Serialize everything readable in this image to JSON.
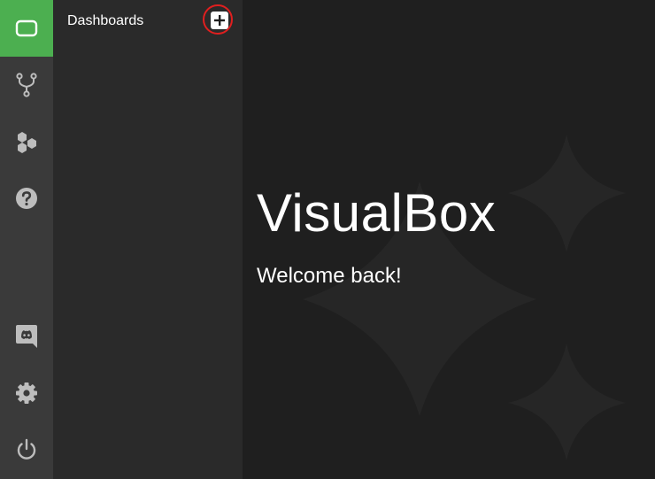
{
  "rail": {
    "items": [
      {
        "icon": "dashboard-icon"
      },
      {
        "icon": "flow-icon"
      },
      {
        "icon": "hexagons-icon"
      },
      {
        "icon": "help-icon"
      },
      {
        "icon": "discord-icon"
      },
      {
        "icon": "gear-icon"
      },
      {
        "icon": "power-icon"
      }
    ]
  },
  "sidebar": {
    "title": "Dashboards",
    "add_icon": "plus-icon"
  },
  "main": {
    "title": "VisualBox",
    "subtitle": "Welcome back!"
  },
  "colors": {
    "accent": "#4caf50",
    "rail_bg": "#3a3a3a",
    "sidebar_bg": "#2a2a2a",
    "main_bg": "#1f1f1f",
    "highlight": "#e01f1f"
  }
}
